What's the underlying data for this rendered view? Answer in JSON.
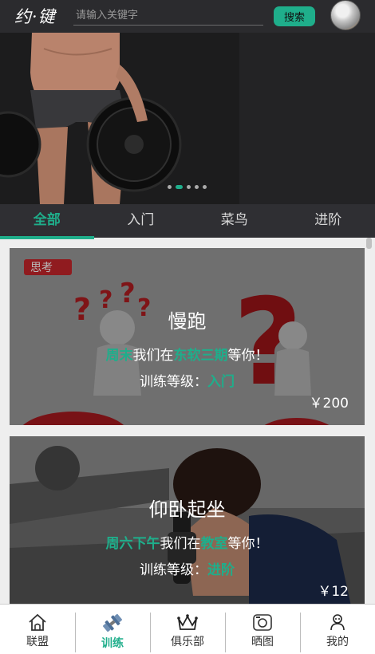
{
  "header": {
    "logo_text": "约·键",
    "search_placeholder": "请输入关键字",
    "search_button": "搜索"
  },
  "banner": {
    "slide_count": 5,
    "active_slide": 2
  },
  "tabs": [
    {
      "label": "全部",
      "active": true
    },
    {
      "label": "入门",
      "active": false
    },
    {
      "label": "菜鸟",
      "active": false
    },
    {
      "label": "进阶",
      "active": false
    }
  ],
  "courses": [
    {
      "title": "慢跑",
      "time": "周末",
      "prefix": "我们在",
      "place": "东软三期",
      "suffix": "等你！",
      "level_label": "训练等级：",
      "level": "入门",
      "price": "￥200",
      "image_text": "思考"
    },
    {
      "title": "仰卧起坐",
      "time": "周六下午",
      "prefix": "我们在",
      "place": "教室",
      "suffix": "等你！",
      "level_label": "训练等级：",
      "level": "进阶",
      "price": "￥12"
    }
  ],
  "bottom_nav": [
    {
      "label": "联盟",
      "icon": "home-icon",
      "active": false
    },
    {
      "label": "训练",
      "icon": "dumbbell-icon",
      "active": true
    },
    {
      "label": "俱乐部",
      "icon": "crown-icon",
      "active": false
    },
    {
      "label": "晒图",
      "icon": "camera-icon",
      "active": false
    },
    {
      "label": "我的",
      "icon": "user-icon",
      "active": false
    }
  ],
  "colors": {
    "accent": "#1fae8b",
    "header_bg": "#2b2b2e",
    "tab_bg": "#2f2f33"
  }
}
